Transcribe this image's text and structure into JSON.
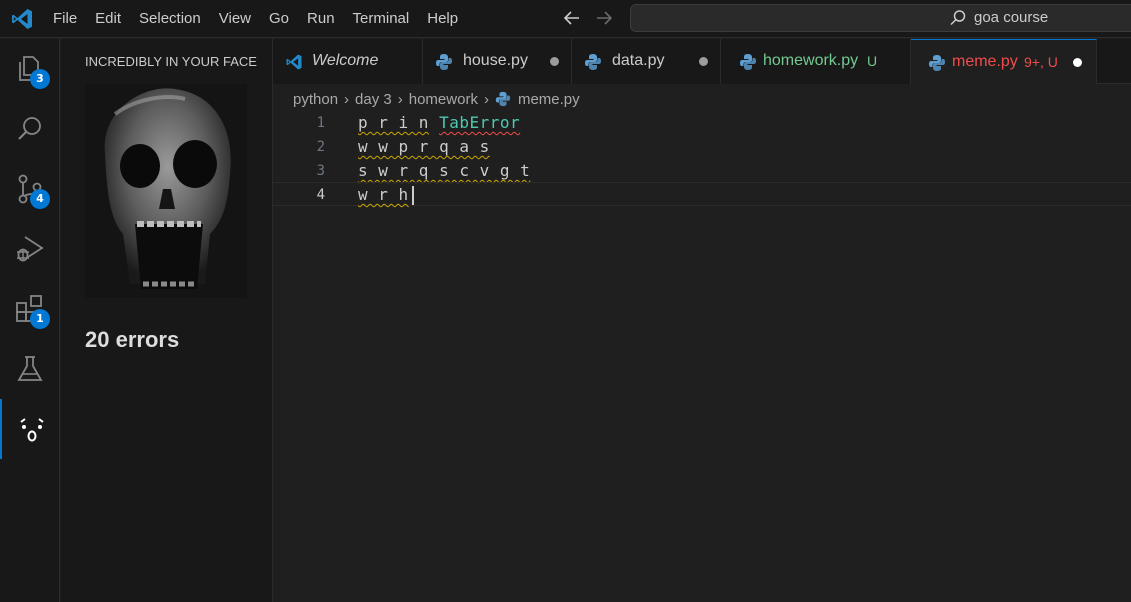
{
  "titlebar": {
    "menu": [
      "File",
      "Edit",
      "Selection",
      "View",
      "Go",
      "Run",
      "Terminal",
      "Help"
    ],
    "search_text": "goa course"
  },
  "activity": {
    "explorer_badge": "3",
    "source_control_badge": "4",
    "extensions_badge": "1"
  },
  "sidebar": {
    "title": "INCREDIBLY IN YOUR FACE",
    "errors_text": "20 errors"
  },
  "tabs": [
    {
      "label": "Welcome",
      "color": "#cccccc"
    },
    {
      "label": "house.py",
      "color": "#cccccc"
    },
    {
      "label": "data.py",
      "color": "#cccccc"
    },
    {
      "label": "homework.py",
      "status": "U",
      "color": "#73c991"
    },
    {
      "label": "meme.py",
      "status": "9+, U",
      "color": "#f14c4c"
    }
  ],
  "breadcrumb": [
    "python",
    "day 3",
    "homework",
    "meme.py"
  ],
  "editor": {
    "lines": [
      {
        "num": "1",
        "squiggle_text": "p r i n",
        "rest": "TabError"
      },
      {
        "num": "2",
        "squiggle_text": "w w p r q a s",
        "rest": ""
      },
      {
        "num": "3",
        "squiggle_text": "s w r q s c v g t",
        "rest": ""
      },
      {
        "num": "4",
        "squiggle_text": "w r h",
        "rest": ""
      }
    ]
  },
  "colors": {
    "accent": "#0078d4",
    "error": "#f14c4c",
    "warning": "#cca700",
    "untracked": "#73c991"
  }
}
